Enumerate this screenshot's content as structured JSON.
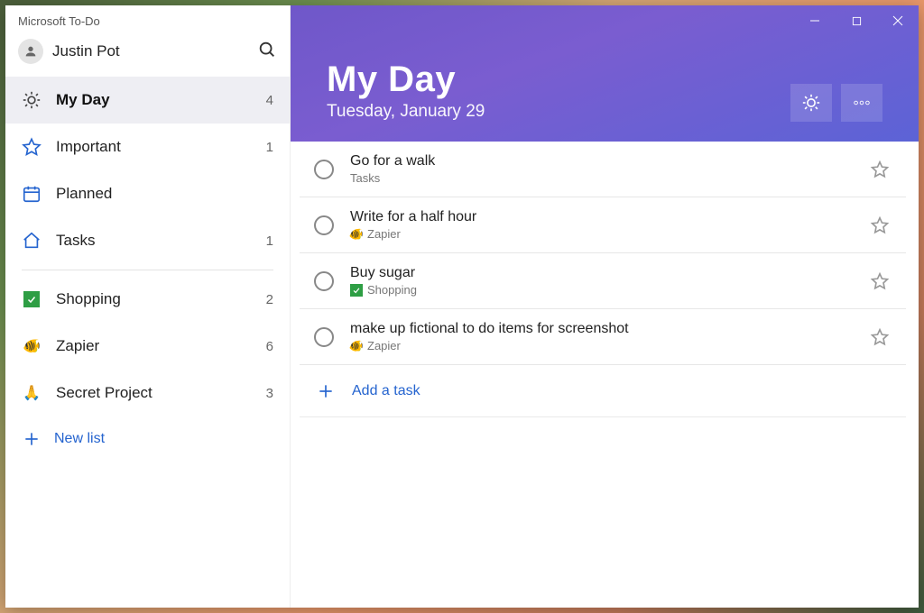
{
  "app_title": "Microsoft To-Do",
  "user_name": "Justin Pot",
  "sidebar": {
    "smart": [
      {
        "id": "myday",
        "label": "My Day",
        "count": "4",
        "icon": "sun",
        "selected": true
      },
      {
        "id": "important",
        "label": "Important",
        "count": "1",
        "icon": "star",
        "selected": false
      },
      {
        "id": "planned",
        "label": "Planned",
        "count": "",
        "icon": "calendar",
        "selected": false
      },
      {
        "id": "tasks",
        "label": "Tasks",
        "count": "1",
        "icon": "home",
        "selected": false
      }
    ],
    "lists": [
      {
        "id": "shopping",
        "label": "Shopping",
        "count": "2",
        "icon": "green-check"
      },
      {
        "id": "zapier",
        "label": "Zapier",
        "count": "6",
        "icon": "fish"
      },
      {
        "id": "secret",
        "label": "Secret Project",
        "count": "3",
        "icon": "pray"
      }
    ],
    "new_list_label": "New list"
  },
  "header": {
    "title": "My Day",
    "date": "Tuesday, January 29"
  },
  "tasks": [
    {
      "title": "Go for a walk",
      "list": "Tasks",
      "list_icon": "none"
    },
    {
      "title": "Write for a half hour",
      "list": "Zapier",
      "list_icon": "fish"
    },
    {
      "title": "Buy sugar",
      "list": "Shopping",
      "list_icon": "green"
    },
    {
      "title": "make up fictional to do items for screenshot",
      "list": "Zapier",
      "list_icon": "fish"
    }
  ],
  "add_task_label": "Add a task"
}
